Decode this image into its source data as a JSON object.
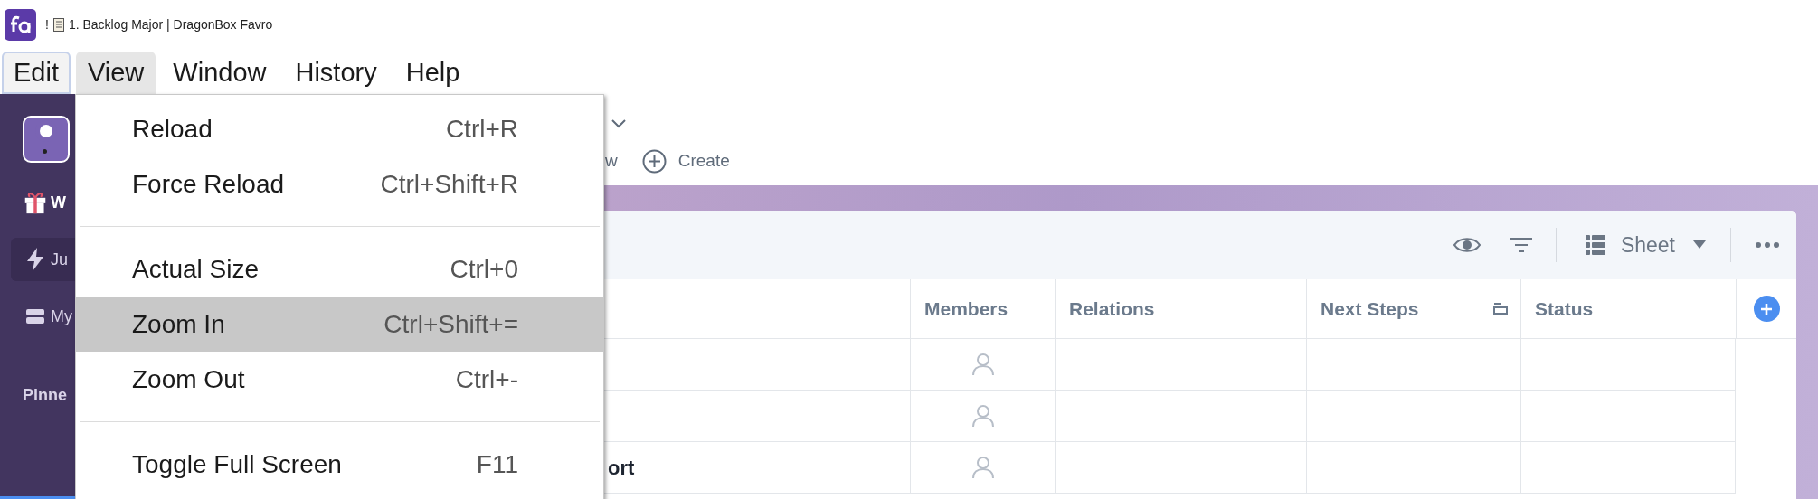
{
  "titlebar": {
    "marker": "!",
    "title": "1. Backlog Major | DragonBox Favro"
  },
  "menubar": [
    {
      "label": "Edit",
      "selected": false,
      "focused": true
    },
    {
      "label": "View",
      "selected": true,
      "focused": false
    },
    {
      "label": "Window",
      "selected": false,
      "focused": false
    },
    {
      "label": "History",
      "selected": false,
      "focused": false
    },
    {
      "label": "Help",
      "selected": false,
      "focused": false
    }
  ],
  "menu": {
    "groups": [
      [
        {
          "label": "Reload",
          "shortcut": "Ctrl+R",
          "selected": false
        },
        {
          "label": "Force Reload",
          "shortcut": "Ctrl+Shift+R",
          "selected": false
        }
      ],
      [
        {
          "label": "Actual Size",
          "shortcut": "Ctrl+0",
          "selected": false
        },
        {
          "label": "Zoom In",
          "shortcut": "Ctrl+Shift+=",
          "selected": true
        },
        {
          "label": "Zoom Out",
          "shortcut": "Ctrl+-",
          "selected": false
        }
      ],
      [
        {
          "label": "Toggle Full Screen",
          "shortcut": "F11",
          "selected": false
        }
      ]
    ]
  },
  "sidebar": {
    "items": [
      {
        "label": "W",
        "kind": "gift",
        "selected": false
      },
      {
        "label": "Ju",
        "kind": "bolt",
        "selected": true
      },
      {
        "label": "My",
        "kind": "list",
        "selected": false
      }
    ],
    "section": "Pinne"
  },
  "header": {
    "partial_label": "w",
    "create_label": "Create"
  },
  "toolbar": {
    "view": "Sheet"
  },
  "table": {
    "columns": [
      {
        "label": "Members",
        "kind": "plain"
      },
      {
        "label": "Relations",
        "kind": "plain"
      },
      {
        "label": "Next Steps",
        "kind": "collapsible"
      },
      {
        "label": "Status",
        "kind": "plain"
      }
    ],
    "rows": [
      {
        "members_assigned": false
      },
      {
        "members_assigned": false
      },
      {
        "title": "ort",
        "members_assigned": false
      }
    ]
  }
}
